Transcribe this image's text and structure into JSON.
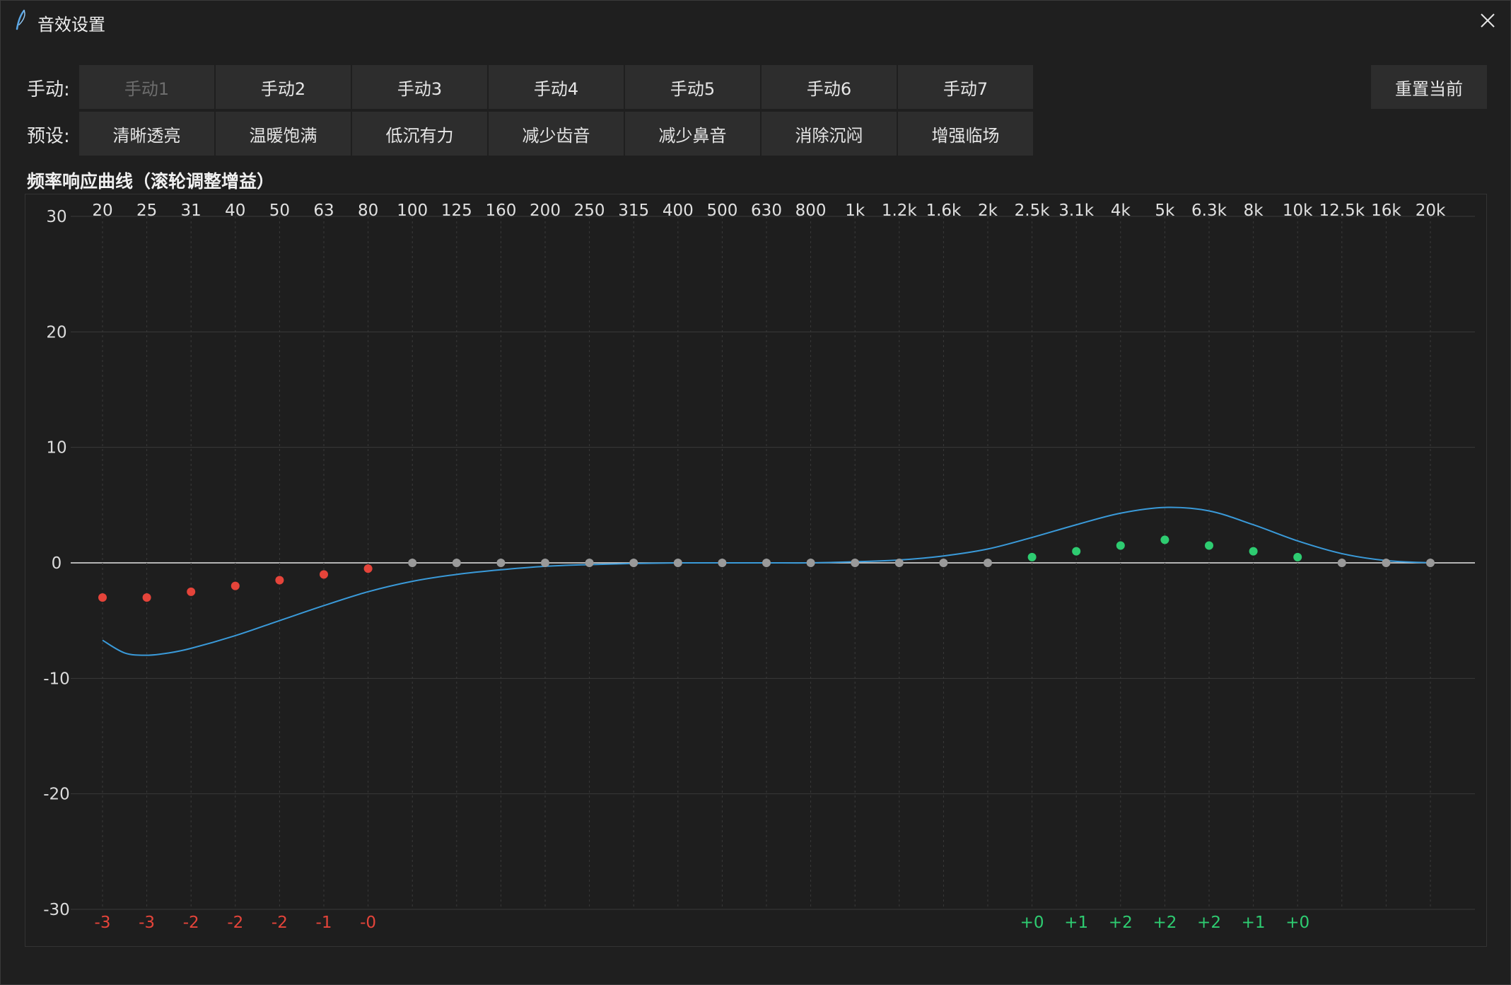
{
  "window": {
    "title": "音效设置",
    "close_icon": "close-icon",
    "title_icon": "feather-icon"
  },
  "manual": {
    "label": "手动:",
    "buttons": [
      "手动1",
      "手动2",
      "手动3",
      "手动4",
      "手动5",
      "手动6",
      "手动7"
    ],
    "disabled_index": 0
  },
  "preset": {
    "label": "预设:",
    "buttons": [
      "清晰透亮",
      "温暖饱满",
      "低沉有力",
      "减少齿音",
      "减少鼻音",
      "消除沉闷",
      "增强临场"
    ]
  },
  "reset_label": "重置当前",
  "colors": {
    "curve": "#3a9ad9",
    "negative": "#e5443a",
    "positive": "#2ecc71",
    "neutral": "#9a9a9a",
    "grid": "#3a3a3a",
    "zero_line": "#e6e6e6"
  },
  "chart_data": {
    "type": "line",
    "title": "频率响应曲线（滚轮调整增益）",
    "ylim": [
      -30,
      30
    ],
    "yticks": [
      "30",
      "20",
      "10",
      "0",
      "-10",
      "-20",
      "-30"
    ],
    "ytick_values": [
      30,
      20,
      10,
      0,
      -10,
      -20,
      -30
    ],
    "bands": [
      "20",
      "25",
      "31",
      "40",
      "50",
      "63",
      "80",
      "100",
      "125",
      "160",
      "200",
      "250",
      "315",
      "400",
      "500",
      "630",
      "800",
      "1k",
      "1.2k",
      "1.6k",
      "2k",
      "2.5k",
      "3.1k",
      "4k",
      "5k",
      "6.3k",
      "8k",
      "10k",
      "12.5k",
      "16k",
      "20k"
    ],
    "gains": [
      -3,
      -3,
      -2.5,
      -2,
      -1.5,
      -1,
      -0.5,
      0,
      0,
      0,
      0,
      0,
      0,
      0,
      0,
      0,
      0,
      0,
      0,
      0,
      0,
      0.5,
      1,
      1.5,
      2,
      1.5,
      1,
      0.5,
      0,
      0,
      0
    ],
    "gain_labels": [
      "-3",
      "-3",
      "-2",
      "-2",
      "-2",
      "-1",
      "-0",
      "",
      "",
      "",
      "",
      "",
      "",
      "",
      "",
      "",
      "",
      "",
      "",
      "",
      "",
      "+0",
      "+1",
      "+2",
      "+2",
      "+2",
      "+1",
      "+0",
      "",
      "",
      ""
    ],
    "response_curve": [
      [
        0,
        -6.7
      ],
      [
        0.5,
        -7.8
      ],
      [
        1,
        -8.0
      ],
      [
        1.5,
        -7.8
      ],
      [
        2,
        -7.4
      ],
      [
        3,
        -6.3
      ],
      [
        4,
        -5.0
      ],
      [
        5,
        -3.7
      ],
      [
        6,
        -2.5
      ],
      [
        7,
        -1.6
      ],
      [
        8,
        -1.0
      ],
      [
        9,
        -0.6
      ],
      [
        10,
        -0.3
      ],
      [
        11,
        -0.15
      ],
      [
        12,
        -0.05
      ],
      [
        13,
        0
      ],
      [
        14,
        0
      ],
      [
        15,
        0
      ],
      [
        16,
        0
      ],
      [
        17,
        0.1
      ],
      [
        18,
        0.25
      ],
      [
        19,
        0.6
      ],
      [
        20,
        1.2
      ],
      [
        21,
        2.2
      ],
      [
        22,
        3.3
      ],
      [
        23,
        4.3
      ],
      [
        24,
        4.8
      ],
      [
        25,
        4.5
      ],
      [
        26,
        3.3
      ],
      [
        27,
        1.9
      ],
      [
        28,
        0.8
      ],
      [
        29,
        0.2
      ],
      [
        30,
        0
      ]
    ]
  }
}
